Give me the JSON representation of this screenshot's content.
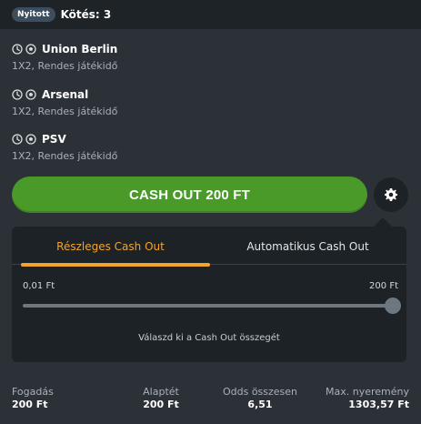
{
  "header": {
    "status_badge": "Nyitott",
    "bets_label": "Kötés: 3"
  },
  "bets": [
    {
      "team": "Union Berlin",
      "market": "1X2, Rendes játékidő"
    },
    {
      "team": "Arsenal",
      "market": "1X2, Rendes játékidő"
    },
    {
      "team": "PSV",
      "market": "1X2, Rendes játékidő"
    }
  ],
  "cashout": {
    "button_label": "CASH OUT 200 FT"
  },
  "panel": {
    "tabs": [
      {
        "label": "Részleges Cash Out",
        "active": true
      },
      {
        "label": "Automatikus Cash Out",
        "active": false
      }
    ],
    "range_min": "0,01 Ft",
    "range_max": "200 Ft",
    "slider_value_fraction": 1.0,
    "hint": "Válaszd ki a Cash Out összegét"
  },
  "footer": {
    "stake_label": "Fogadás",
    "stake_value": "200 Ft",
    "base_stake_label": "Alaptét",
    "base_stake_value": "200 Ft",
    "total_odds_label": "Odds összesen",
    "total_odds_value": "6,51",
    "max_win_label": "Max. nyeremény",
    "max_win_value": "1303,57 Ft"
  },
  "colors": {
    "background": "#2b3136",
    "header_bg": "#1e2327",
    "panel_bg": "#1d2226",
    "cashout_green": "#4a9a2a",
    "accent_orange": "#f3a42c"
  },
  "icons": {
    "clock": "clock-icon",
    "ball": "football-icon",
    "gear": "gear-icon"
  }
}
